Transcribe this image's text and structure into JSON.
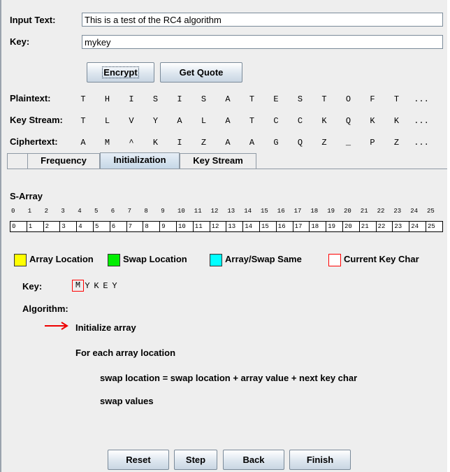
{
  "input_text_label": "Input Text:",
  "input_text_value": "This is a test of the RC4 algorithm",
  "key_label": "Key:",
  "key_value": "mykey",
  "buttons": {
    "encrypt": "Encrypt",
    "get_quote": "Get Quote"
  },
  "rows": {
    "plaintext": {
      "label": "Plaintext:",
      "chars": [
        "T",
        "H",
        "I",
        "S",
        "I",
        "S",
        "A",
        "T",
        "E",
        "S",
        "T",
        "O",
        "F",
        "T",
        "..."
      ]
    },
    "keystream": {
      "label": "Key Stream:",
      "chars": [
        "T",
        "L",
        "V",
        "Y",
        "A",
        "L",
        "A",
        "T",
        "C",
        "C",
        "K",
        "Q",
        "K",
        "K",
        "..."
      ]
    },
    "ciphertext": {
      "label": "Ciphertext:",
      "chars": [
        "A",
        "M",
        "^",
        "K",
        "I",
        "Z",
        "A",
        "A",
        "G",
        "Q",
        "Z",
        "_",
        "P",
        "Z",
        "..."
      ]
    }
  },
  "tabs": [
    "Frequency",
    "Initialization",
    "Key Stream"
  ],
  "selected_tab": "Initialization",
  "s_array": {
    "title": "S-Array",
    "indices": [
      "0",
      "1",
      "2",
      "3",
      "4",
      "5",
      "6",
      "7",
      "8",
      "9",
      "10",
      "11",
      "12",
      "13",
      "14",
      "15",
      "16",
      "17",
      "18",
      "19",
      "20",
      "21",
      "22",
      "23",
      "24",
      "25"
    ],
    "values": [
      "0",
      "1",
      "2",
      "3",
      "4",
      "5",
      "6",
      "7",
      "8",
      "9",
      "10",
      "11",
      "12",
      "13",
      "14",
      "15",
      "16",
      "17",
      "18",
      "19",
      "20",
      "21",
      "22",
      "23",
      "24",
      "25"
    ]
  },
  "legend": [
    {
      "label": "Array Location",
      "color": "#ffff00"
    },
    {
      "label": "Swap Location",
      "color": "#00ee00"
    },
    {
      "label": "Array/Swap Same",
      "color": "#00ffff"
    },
    {
      "label": "Current Key Char",
      "color": "#ff0000"
    }
  ],
  "key_display": {
    "label": "Key:",
    "chars": [
      "M",
      "Y",
      "K",
      "E",
      "Y"
    ],
    "current_index": 0
  },
  "algorithm": {
    "label": "Algorithm:",
    "steps": [
      "Initialize array",
      "For each array location",
      "swap location = swap location + array value + next key char",
      "swap values"
    ],
    "current_step": 0
  },
  "controls": {
    "reset": "Reset",
    "step": "Step",
    "back": "Back",
    "finish": "Finish"
  }
}
